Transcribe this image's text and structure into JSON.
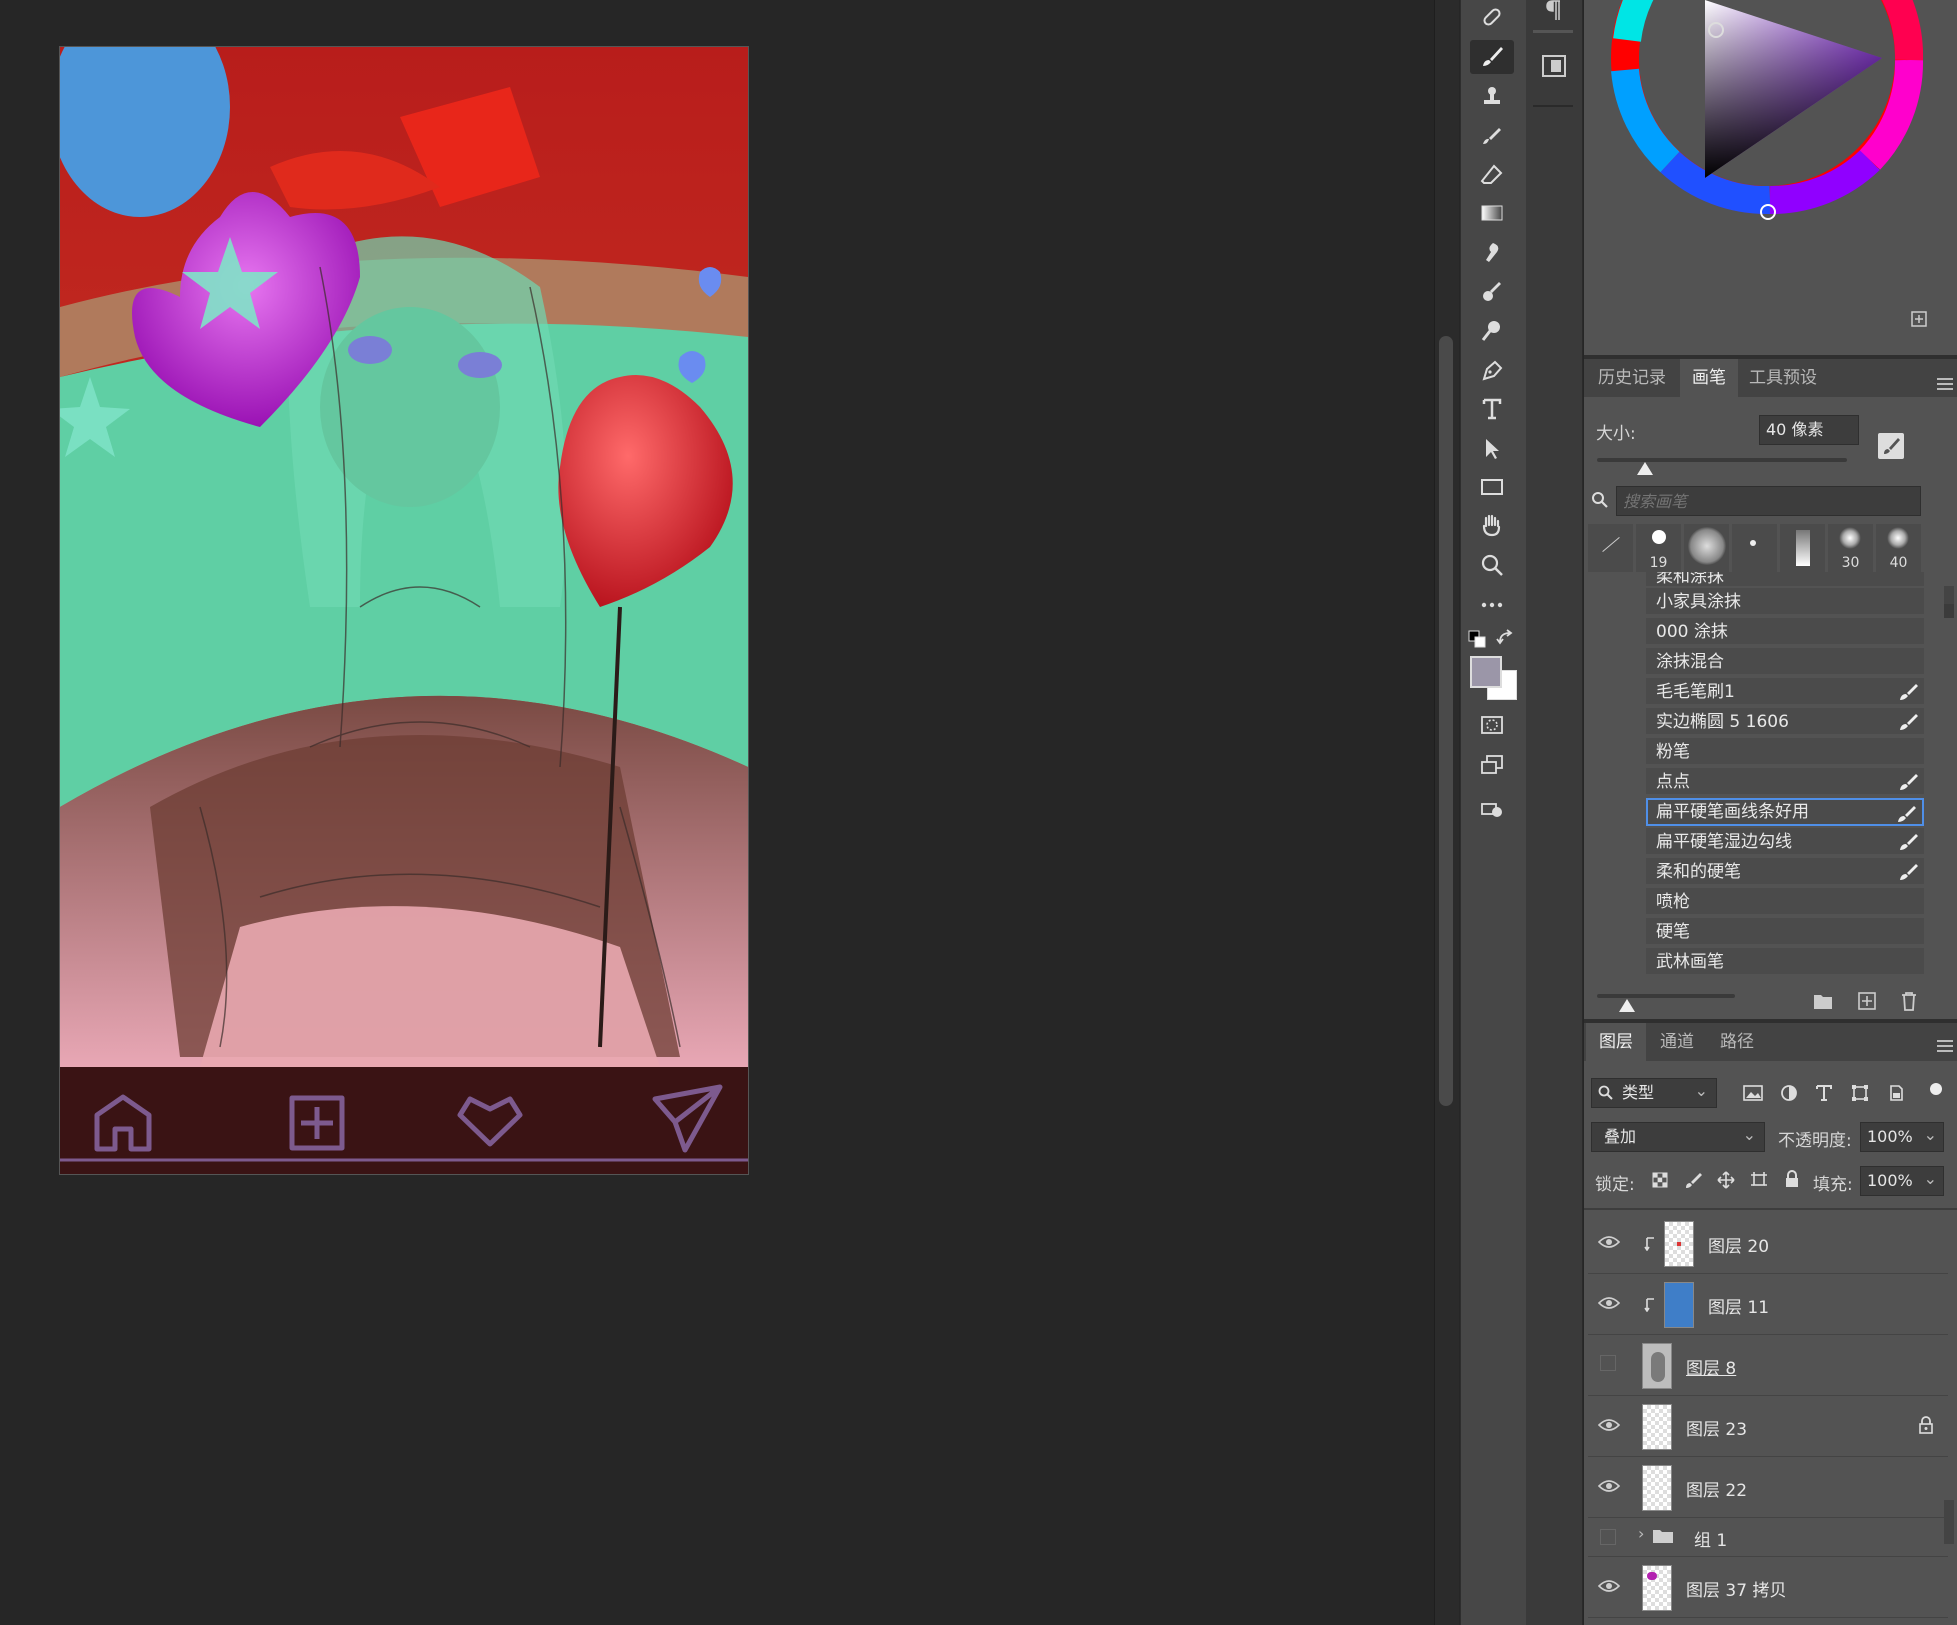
{
  "brush_panel": {
    "tabs": [
      "历史记录",
      "画笔",
      "工具预设"
    ],
    "size_label": "大小:",
    "size_value": "40 像素",
    "search_placeholder": "搜索画笔",
    "presets": [
      {
        "kind": "line",
        "num": ""
      },
      {
        "kind": "hard",
        "num": "19"
      },
      {
        "kind": "soft-big",
        "num": ""
      },
      {
        "kind": "dot",
        "num": ""
      },
      {
        "kind": "streak",
        "num": ""
      },
      {
        "kind": "soft",
        "num": "30"
      },
      {
        "kind": "soft",
        "num": "40"
      }
    ],
    "partial_item": "柔和涂抹",
    "items": [
      {
        "label": "小家具涂抹",
        "has_icon": false
      },
      {
        "label": "000 涂抹",
        "has_icon": false
      },
      {
        "label": "涂抹混合",
        "has_icon": false
      },
      {
        "label": "毛毛笔刷1",
        "has_icon": true
      },
      {
        "label": "实边椭圆 5 1606",
        "has_icon": true
      },
      {
        "label": "粉笔",
        "has_icon": false
      },
      {
        "label": "点点",
        "has_icon": true
      },
      {
        "label": "扁平硬笔画线条好用",
        "has_icon": true,
        "selected": true
      },
      {
        "label": "扁平硬笔湿边勾线",
        "has_icon": true
      },
      {
        "label": "柔和的硬笔",
        "has_icon": true
      },
      {
        "label": "喷枪",
        "has_icon": false
      },
      {
        "label": "硬笔",
        "has_icon": false
      },
      {
        "label": "武林画笔",
        "has_icon": false
      }
    ]
  },
  "layers_panel": {
    "tabs": [
      "图层",
      "通道",
      "路径"
    ],
    "filter_label": "类型",
    "blend_mode": "叠加",
    "opacity_label": "不透明度:",
    "opacity_value": "100%",
    "lock_label": "锁定:",
    "fill_label": "填充:",
    "fill_value": "100%",
    "layers": [
      {
        "name": "图层 20",
        "visible": true,
        "clipped": true,
        "thumb": "checker-dots"
      },
      {
        "name": "图层 11",
        "visible": true,
        "clipped": true,
        "thumb": "blue"
      },
      {
        "name": "图层 8",
        "visible": false,
        "clipped": false,
        "thumb": "sketch"
      },
      {
        "name": "图层 23",
        "visible": true,
        "clipped": false,
        "thumb": "checker",
        "locked": true
      },
      {
        "name": "图层 22",
        "visible": true,
        "clipped": false,
        "thumb": "checker"
      },
      {
        "name": "组 1",
        "visible": false,
        "group": true
      },
      {
        "name": "图层 37 拷贝",
        "visible": true,
        "clipped": false,
        "thumb": "checker-purple"
      }
    ]
  },
  "colors": {
    "foreground": "#9b96a8",
    "background": "#ffffff",
    "accent_selection": "#4f8fe8"
  },
  "tools": [
    "healing-brush",
    "brush",
    "clone-stamp",
    "history-brush",
    "eraser",
    "gradient",
    "smudge",
    "blur",
    "dodge",
    "pen",
    "type",
    "path-select",
    "rectangle",
    "hand",
    "zoom",
    "more"
  ]
}
